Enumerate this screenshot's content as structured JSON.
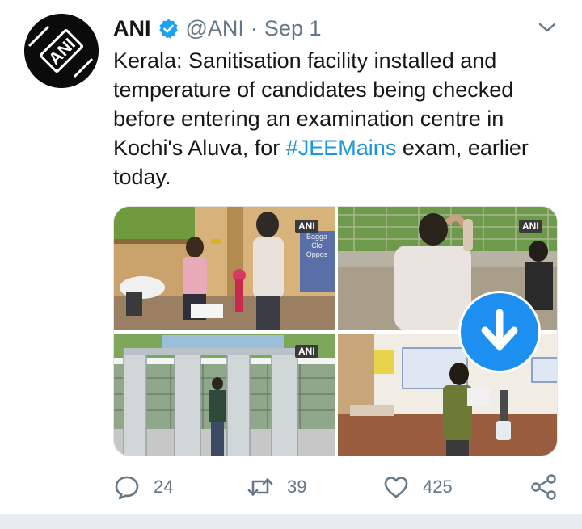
{
  "tweet": {
    "author_name": "ANI",
    "handle": "@ANI",
    "separator": "·",
    "date": "Sep 1",
    "text_before": "Kerala: Sanitisation facility installed and temperature of candidates being checked before entering an examination centre in Kochi's Aluva, for ",
    "hashtag": "#JEEMains",
    "text_after": " exam, earlier today.",
    "avatar_logo_text": "ANI"
  },
  "media": {
    "watermarks": [
      "ANI",
      "ANI",
      "ANI"
    ],
    "sign_lines": [
      "Bagga",
      "Clo",
      "Oppos"
    ]
  },
  "actions": {
    "replies": "24",
    "retweets": "39",
    "likes": "425"
  },
  "icons": {
    "verified": "verified-badge-icon",
    "caret": "chevron-down-icon",
    "reply": "reply-icon",
    "retweet": "retweet-icon",
    "like": "heart-icon",
    "share": "share-icon",
    "download": "download-arrow-icon"
  },
  "colors": {
    "accent": "#1b95e0",
    "muted": "#657786",
    "download_button": "#1d8ff0",
    "text": "#14171a"
  }
}
